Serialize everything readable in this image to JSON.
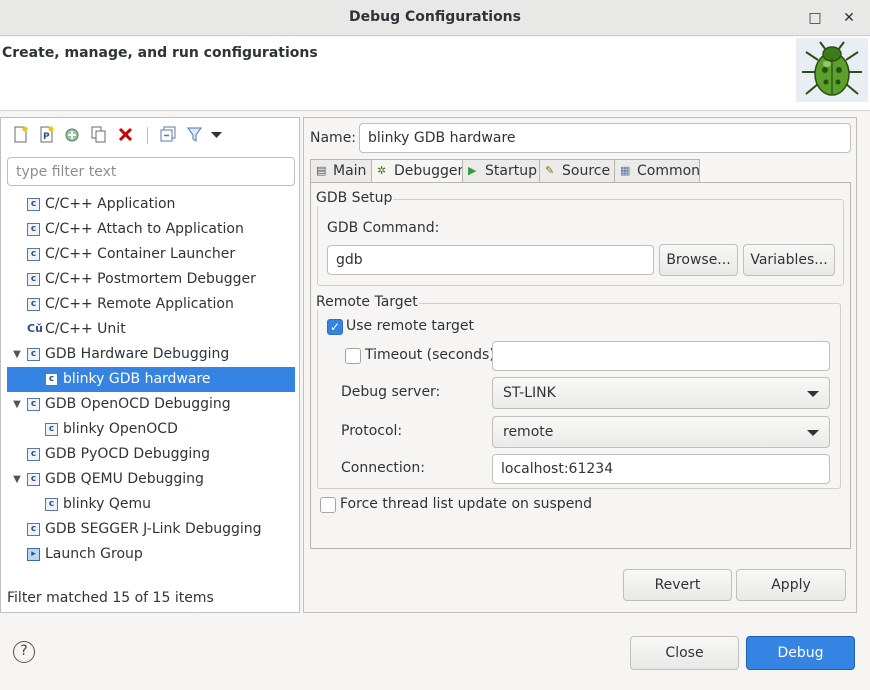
{
  "window": {
    "title": "Debug Configurations",
    "maximize_glyph": "□",
    "close_glyph": "✕"
  },
  "header": {
    "title": "Create, manage, and run configurations",
    "icon": "bug-icon"
  },
  "left": {
    "toolbar_icons": [
      "new-config-icon",
      "new-prototype-icon",
      "export-icon",
      "duplicate-icon",
      "delete-icon",
      "collapse-all-icon",
      "filter-icon",
      "view-menu-icon"
    ],
    "filter_placeholder": "type filter text",
    "tree": [
      {
        "label": "C/C++ Application",
        "level": 0,
        "expander": "",
        "icon": "c"
      },
      {
        "label": "C/C++ Attach to Application",
        "level": 0,
        "expander": "",
        "icon": "c"
      },
      {
        "label": "C/C++ Container Launcher",
        "level": 0,
        "expander": "",
        "icon": "c"
      },
      {
        "label": "C/C++ Postmortem Debugger",
        "level": 0,
        "expander": "",
        "icon": "c"
      },
      {
        "label": "C/C++ Remote Application",
        "level": 0,
        "expander": "",
        "icon": "c"
      },
      {
        "label": "C/C++ Unit",
        "level": 0,
        "expander": "",
        "icon": "cu"
      },
      {
        "label": "GDB Hardware Debugging",
        "level": 0,
        "expander": "▼",
        "icon": "c"
      },
      {
        "label": "blinky GDB hardware",
        "level": 1,
        "expander": "",
        "icon": "c",
        "selected": true
      },
      {
        "label": "GDB OpenOCD Debugging",
        "level": 0,
        "expander": "▼",
        "icon": "c"
      },
      {
        "label": "blinky OpenOCD",
        "level": 1,
        "expander": "",
        "icon": "c"
      },
      {
        "label": "GDB PyOCD Debugging",
        "level": 0,
        "expander": "",
        "icon": "c"
      },
      {
        "label": "GDB QEMU Debugging",
        "level": 0,
        "expander": "▼",
        "icon": "c"
      },
      {
        "label": "blinky Qemu",
        "level": 1,
        "expander": "",
        "icon": "c"
      },
      {
        "label": "GDB SEGGER J-Link Debugging",
        "level": 0,
        "expander": "",
        "icon": "c"
      },
      {
        "label": "Launch Group",
        "level": 0,
        "expander": "",
        "icon": "group"
      }
    ],
    "status": "Filter matched 15 of 15 items"
  },
  "right": {
    "name_label": "Name:",
    "name_value": "blinky GDB hardware",
    "tabs": [
      {
        "label": "Main",
        "icon": "main-tab-icon",
        "glyph": "▤"
      },
      {
        "label": "Debugger",
        "icon": "debugger-tab-icon",
        "glyph": "✲",
        "active": true
      },
      {
        "label": "Startup",
        "icon": "startup-tab-icon",
        "glyph": "▶"
      },
      {
        "label": "Source",
        "icon": "source-tab-icon",
        "glyph": "✎"
      },
      {
        "label": "Common",
        "icon": "common-tab-icon",
        "glyph": "▦"
      }
    ],
    "gdb_setup": {
      "legend": "GDB Setup",
      "command_label": "GDB Command:",
      "command_value": "gdb",
      "browse": "Browse...",
      "variables": "Variables..."
    },
    "remote": {
      "legend": "Remote Target",
      "use_remote_label": "Use remote target",
      "use_remote_checked": true,
      "timeout_label": "Timeout (seconds):",
      "timeout_checked": false,
      "timeout_value": "",
      "debug_server_label": "Debug server:",
      "debug_server_value": "ST-LINK",
      "protocol_label": "Protocol:",
      "protocol_value": "remote",
      "connection_label": "Connection:",
      "connection_value": "localhost:61234"
    },
    "force_thread_label": "Force thread list update on suspend",
    "force_thread_checked": false,
    "revert": "Revert",
    "apply": "Apply"
  },
  "footer": {
    "help_glyph": "?",
    "close": "Close",
    "debug": "Debug"
  },
  "colors": {
    "accent": "#3584e4",
    "delete_red": "#cc0000"
  }
}
